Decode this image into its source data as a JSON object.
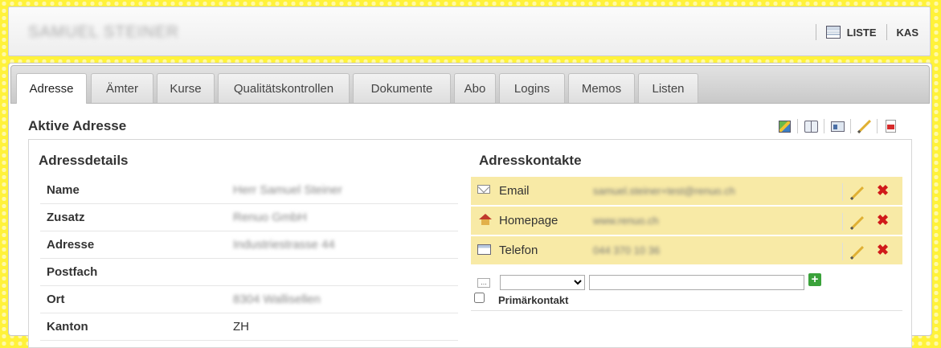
{
  "header": {
    "person_name": "SAMUEL STEINER",
    "nav": [
      {
        "label": "LISTE",
        "icon": "list-icon"
      },
      {
        "label": "KAS"
      }
    ]
  },
  "tabs": [
    "Adresse",
    "Ämter",
    "Kurse",
    "Qualitätskontrollen",
    "Dokumente",
    "Abo",
    "Logins",
    "Memos",
    "Listen"
  ],
  "active_tab": "Adresse",
  "section": {
    "title": "Aktive Adresse",
    "toolbar_icons": [
      "image-icon",
      "book-icon",
      "card-icon",
      "pencil-icon",
      "pdf-icon"
    ]
  },
  "details": {
    "title": "Adressdetails",
    "rows": [
      {
        "label": "Name",
        "value": "Herr Samuel Steiner"
      },
      {
        "label": "Zusatz",
        "value": "Renuo GmbH"
      },
      {
        "label": "Adresse",
        "value": "Industriestrasse 44"
      },
      {
        "label": "Postfach",
        "value": ""
      },
      {
        "label": "Ort",
        "value": "8304 Wallisellen"
      },
      {
        "label": "Kanton",
        "value": "ZH"
      }
    ]
  },
  "contacts": {
    "title": "Adresskontakte",
    "rows": [
      {
        "label": "Email",
        "value": "samuel.steiner+test@renuo.ch",
        "icon": "mail-icon"
      },
      {
        "label": "Homepage",
        "value": "www.renuo.ch",
        "icon": "home-icon"
      },
      {
        "label": "Telefon",
        "value": "044 370 10 36",
        "icon": "phone-icon"
      }
    ],
    "primary_label": "Primärkontakt",
    "accent_color": "#f8eaa6"
  }
}
